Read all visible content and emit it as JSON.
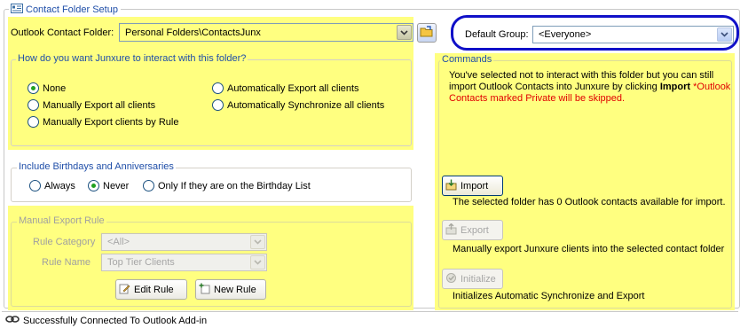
{
  "frame": {
    "title": "Contact Folder Setup"
  },
  "folder": {
    "label": "Outlook Contact Folder:",
    "value": "Personal Folders\\ContactsJunx"
  },
  "default_group": {
    "label": "Default Group:",
    "value": "<Everyone>"
  },
  "interaction": {
    "title": "How do you want Junxure to interact with this folder?",
    "options": [
      {
        "label": "None",
        "selected": true
      },
      {
        "label": "Manually Export all clients",
        "selected": false
      },
      {
        "label": "Manually Export clients by Rule",
        "selected": false
      },
      {
        "label": "Automatically Export all clients",
        "selected": false
      },
      {
        "label": "Automatically Synchronize all clients",
        "selected": false
      }
    ]
  },
  "birthdays": {
    "title": "Include Birthdays and Anniversaries",
    "options": [
      {
        "label": "Always",
        "selected": false
      },
      {
        "label": "Never",
        "selected": true
      },
      {
        "label": "Only If they are on the Birthday List",
        "selected": false
      }
    ]
  },
  "manual_rule": {
    "title": "Manual Export Rule",
    "category_label": "Rule Category",
    "category_value": "<All>",
    "name_label": "Rule Name",
    "name_value": "Top Tier Clients",
    "edit_label": "Edit Rule",
    "new_label": "New Rule"
  },
  "commands": {
    "title": "Commands",
    "message_part1": "You've selected not to interact with this folder but you can still import Outlook Contacts into Junxure by clicking ",
    "message_bold": "Import",
    "message_red": " *Outlook Contacts marked Private will be skipped.",
    "import_label": "Import",
    "import_desc": "The selected folder has 0 Outlook contacts available for import.",
    "export_label": "Export",
    "export_desc": "Manually export Junxure clients into the selected contact folder",
    "initialize_label": "Initialize",
    "initialize_desc": "Initializes Automatic Synchronize and Export"
  },
  "status": {
    "text": "Successfully Connected To Outlook Add-in"
  },
  "colors": {
    "highlight": "#ffff80",
    "accent_blue": "#1f4ea8",
    "annotation": "#1010c8",
    "warning_red": "#e00000"
  }
}
